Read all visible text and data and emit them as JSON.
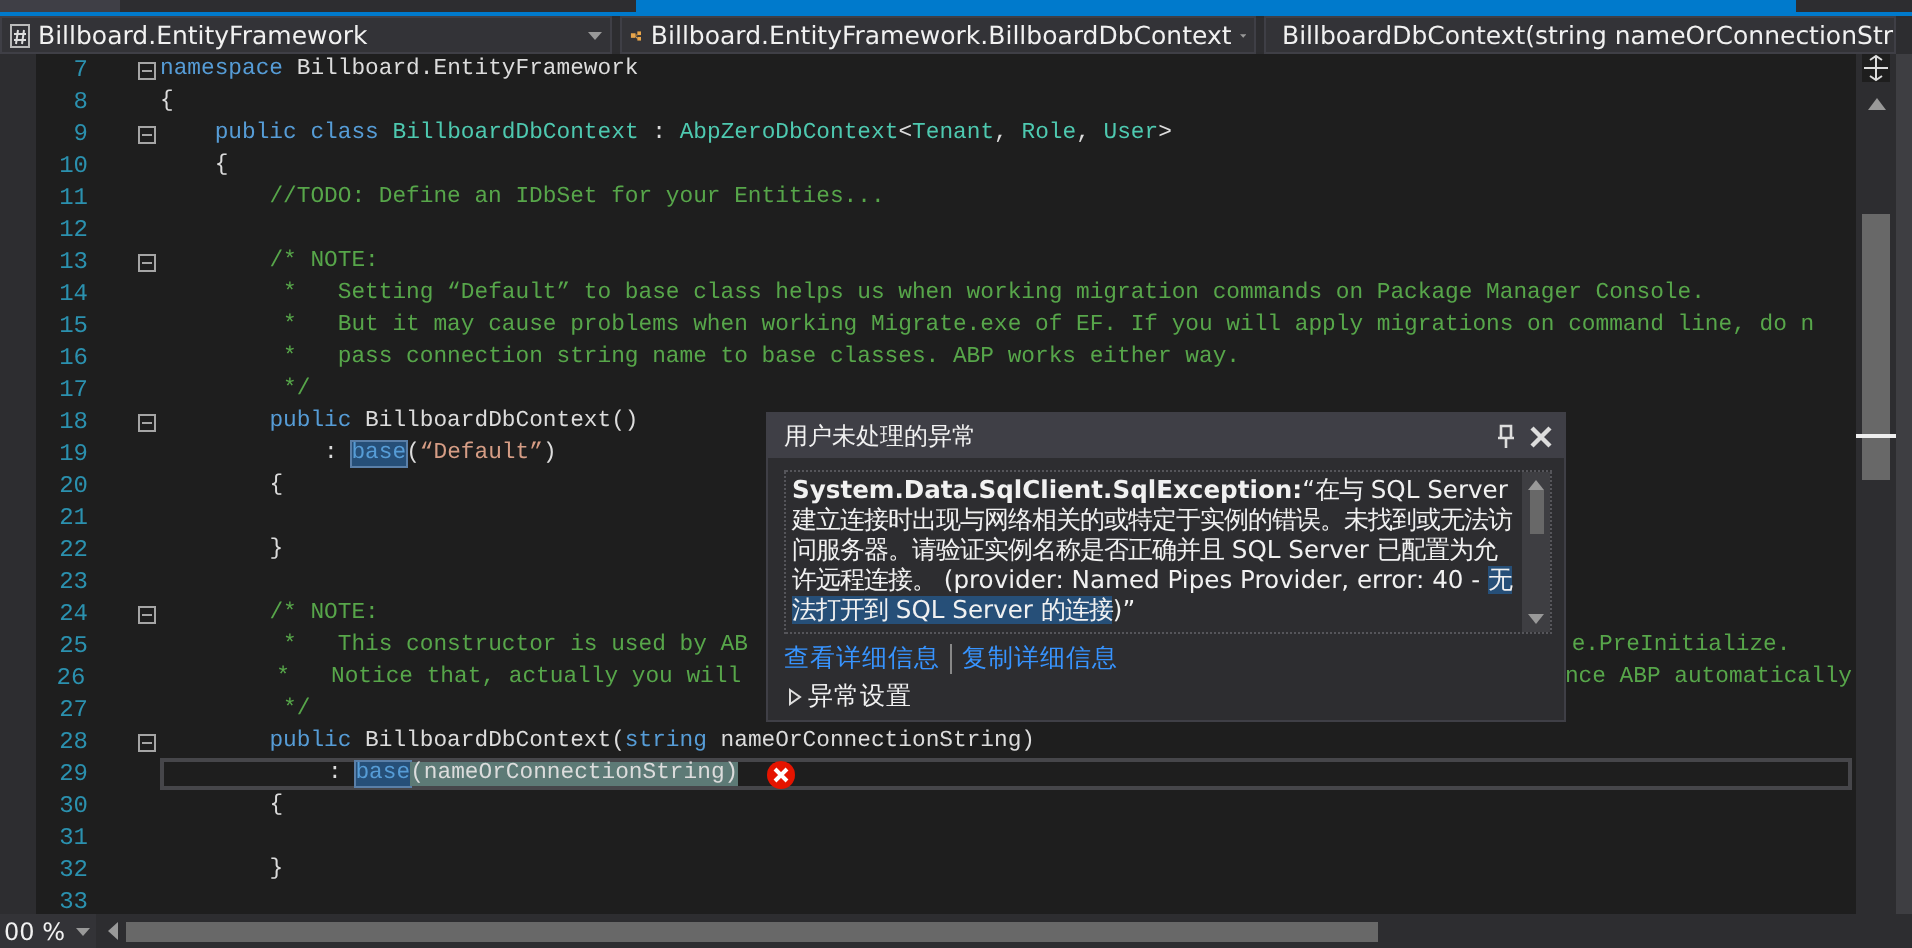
{
  "nav_bar": {
    "dropdowns": [
      {
        "kind": "project",
        "text": "Billboard.EntityFramework"
      },
      {
        "kind": "class",
        "text": "Billboard.EntityFramework.BillboardDbContext"
      },
      {
        "kind": "method",
        "text": "BillboardDbContext(string nameOrConnectionStr"
      }
    ]
  },
  "editor": {
    "lines": [
      {
        "number": "7",
        "fold_box": true,
        "current": false,
        "segments": [
          {
            "kind": "keyword",
            "text": "namespace"
          },
          {
            "kind": "plain",
            "text": " Billboard.EntityFramework"
          }
        ]
      },
      {
        "number": "8",
        "fold_box": false,
        "current": false,
        "segments": [
          {
            "kind": "plain",
            "text": "{"
          }
        ]
      },
      {
        "number": "9",
        "fold_box": true,
        "current": false,
        "segments": [
          {
            "kind": "keyword",
            "text": "    public"
          },
          {
            "kind": "keyword",
            "text": " class"
          },
          {
            "kind": "type",
            "text": " BillboardDbContext"
          },
          {
            "kind": "plain",
            "text": " :"
          },
          {
            "kind": "type",
            "text": " AbpZeroDbContext"
          },
          {
            "kind": "plain",
            "text": "<"
          },
          {
            "kind": "type",
            "text": "Tenant"
          },
          {
            "kind": "plain",
            "text": ","
          },
          {
            "kind": "type",
            "text": " Role"
          },
          {
            "kind": "plain",
            "text": ","
          },
          {
            "kind": "type",
            "text": " User"
          },
          {
            "kind": "plain",
            "text": ">"
          }
        ]
      },
      {
        "number": "10",
        "fold_box": false,
        "current": false,
        "segments": [
          {
            "kind": "plain",
            "text": "    {"
          }
        ]
      },
      {
        "number": "11",
        "fold_box": false,
        "current": false,
        "segments": [
          {
            "kind": "comment",
            "text": "        //TODO: Define an IDbSet for your Entities..."
          }
        ]
      },
      {
        "number": "12",
        "fold_box": false,
        "current": false
      },
      {
        "number": "13",
        "fold_box": true,
        "current": false,
        "segments": [
          {
            "kind": "comment",
            "text": "        /* NOTE:"
          }
        ]
      },
      {
        "number": "14",
        "fold_box": false,
        "current": false,
        "segments": [
          {
            "kind": "comment",
            "text": "         *   Setting “Default” to base class helps us when working migration commands on Package Manager Console."
          }
        ]
      },
      {
        "number": "15",
        "fold_box": false,
        "current": false,
        "segments": [
          {
            "kind": "comment",
            "text": "         *   But it may cause problems when working Migrate.exe of EF. If you will apply migrations on command line, do n"
          }
        ]
      },
      {
        "number": "16",
        "fold_box": false,
        "current": false,
        "segments": [
          {
            "kind": "comment",
            "text": "         *   pass connection string name to base classes. ABP works either way."
          }
        ]
      },
      {
        "number": "17",
        "fold_box": false,
        "current": false,
        "segments": [
          {
            "kind": "comment",
            "text": "         */"
          }
        ]
      },
      {
        "number": "18",
        "fold_box": true,
        "current": false,
        "segments": [
          {
            "kind": "keyword",
            "text": "        public"
          },
          {
            "kind": "plain",
            "text": " BillboardDbContext()"
          }
        ]
      },
      {
        "number": "19",
        "fold_box": false,
        "current": false,
        "segments": [
          {
            "kind": "plain",
            "text": "            :"
          },
          {
            "kind": "keyword",
            "text": " base",
            "reference_highlight": true
          },
          {
            "kind": "plain",
            "text": "("
          },
          {
            "kind": "string",
            "text": "“Default”"
          },
          {
            "kind": "plain",
            "text": ")"
          }
        ]
      },
      {
        "number": "20",
        "fold_box": false,
        "current": false,
        "segments": [
          {
            "kind": "plain",
            "text": "        {"
          }
        ]
      },
      {
        "number": "21",
        "fold_box": false,
        "current": false
      },
      {
        "number": "22",
        "fold_box": false,
        "current": false,
        "segments": [
          {
            "kind": "plain",
            "text": "        }"
          }
        ]
      },
      {
        "number": "23",
        "fold_box": false,
        "current": false
      },
      {
        "number": "24",
        "fold_box": true,
        "current": false,
        "segments": [
          {
            "kind": "comment",
            "text": "        /* NOTE:"
          }
        ]
      },
      {
        "number": "25",
        "fold_box": false,
        "current": false,
        "segments": [
          {
            "kind": "comment",
            "text": "         *   This constructor is used by AB"
          }
        ],
        "segments_after_popup": [
          {
            "kind": "comment",
            "text": "e.PreInitialize."
          }
        ]
      },
      {
        "number": "26",
        "fold_box": false,
        "current": false,
        "segments": [
          {
            "kind": "comment",
            "text": "         *   Notice that, actually you will"
          }
        ],
        "segments_after_popup": [
          {
            "kind": "comment",
            "text": "nce ABP automatically"
          }
        ]
      },
      {
        "number": "27",
        "fold_box": false,
        "current": false,
        "segments": [
          {
            "kind": "comment",
            "text": "         */"
          }
        ]
      },
      {
        "number": "28",
        "fold_box": true,
        "current": false,
        "segments": [
          {
            "kind": "keyword",
            "text": "        public"
          },
          {
            "kind": "plain",
            "text": " BillboardDbContext("
          },
          {
            "kind": "keyword",
            "text": "string"
          },
          {
            "kind": "plain",
            "text": " nameOrConnectionString)"
          }
        ]
      },
      {
        "number": "29",
        "fold_box": false,
        "current": true,
        "error": true,
        "segments": [
          {
            "kind": "plain",
            "text": "            :"
          },
          {
            "kind": "keyword",
            "text": " base",
            "reference_highlight": true
          },
          {
            "kind": "plain",
            "text": "(nameOrConnectionString)",
            "statement_highlight": true
          }
        ]
      },
      {
        "number": "30",
        "fold_box": false,
        "current": false,
        "segments": [
          {
            "kind": "plain",
            "text": "        {"
          }
        ]
      },
      {
        "number": "31",
        "fold_box": false,
        "current": false
      },
      {
        "number": "32",
        "fold_box": false,
        "current": false,
        "segments": [
          {
            "kind": "plain",
            "text": "        }"
          }
        ]
      },
      {
        "number": "33",
        "fold_box": false,
        "current": false
      }
    ]
  },
  "exception_popup": {
    "title": "用户未处理的异常",
    "message": [
      {
        "text": "System.Data.SqlClient.SqlException:",
        "bold": true,
        "selected": false
      },
      {
        "text": "“在与 SQL Server 建立连接时出现与网络相关的或特定于实例的错误。未找到或无法访问服务器。请验证实例名称是否正确并且 SQL Server 已配置为允许远程连接。 (provider: Named Pipes Provider, error: 40 - ",
        "bold": false,
        "selected": false
      },
      {
        "text": "无法打开到 SQL Server 的连接",
        "bold": false,
        "selected": true
      },
      {
        "text": ")”",
        "bold": false,
        "selected": false
      }
    ],
    "links": [
      "查看详细信息",
      "复制详细信息"
    ],
    "settings": {
      "label": "异常设置",
      "expanded": false
    }
  },
  "status_bar": {
    "zoom": "00 %"
  }
}
